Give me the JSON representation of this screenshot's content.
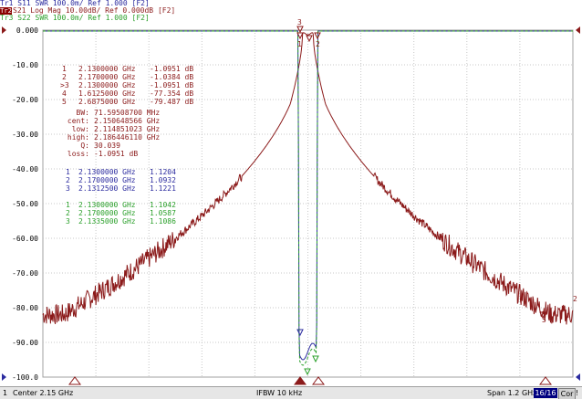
{
  "traces_header": [
    {
      "id": "Tr1",
      "label": "S11  SWR 100.0m/ Ref 1.000  [F2]",
      "color": "#2b2b9f"
    },
    {
      "id": "Tr2",
      "label": "S21  Log Mag 10.00dB/ Ref 0.000dB  [F2]",
      "color": "#8b1a1a"
    },
    {
      "id": "Tr3",
      "label": "S22  SWR 100.0m/ Ref 1.000  [F2]",
      "color": "#2ba02b"
    }
  ],
  "y_axis": {
    "ticks": [
      "0.000",
      "-10.00",
      "-20.00",
      "-30.00",
      "-40.00",
      "-50.00",
      "-60.00",
      "-70.00",
      "-80.00",
      "-90.00",
      "-100.0"
    ],
    "min": -100,
    "max": 0
  },
  "markers_s21": [
    {
      "num": "1",
      "freq": "2.1300000 GHz",
      "val": "-1.0951 dB"
    },
    {
      "num": "2",
      "freq": "2.1700000 GHz",
      "val": "-1.0384 dB"
    },
    {
      "num": ">3",
      "freq": "2.1300000 GHz",
      "val": "-1.0951 dB"
    },
    {
      "num": "4",
      "freq": "1.6125000 GHz",
      "val": "-77.354 dB"
    },
    {
      "num": "5",
      "freq": "2.6875000 GHz",
      "val": "-79.487 dB"
    }
  ],
  "bandwidth": [
    {
      "key": "BW:",
      "val": "71.59508700 MHz"
    },
    {
      "key": "cent:",
      "val": "2.150648566 GHz"
    },
    {
      "key": "low:",
      "val": "2.114851023 GHz"
    },
    {
      "key": "high:",
      "val": "2.186446110 GHz"
    },
    {
      "key": "Q:",
      "val": "30.039"
    },
    {
      "key": "loss:",
      "val": "-1.0951 dB"
    }
  ],
  "markers_s11": [
    {
      "num": "1",
      "freq": "2.1300000 GHz",
      "val": "1.1204"
    },
    {
      "num": "2",
      "freq": "2.1700000 GHz",
      "val": "1.0932"
    },
    {
      "num": "3",
      "freq": "2.1312500 GHz",
      "val": "1.1221"
    }
  ],
  "markers_s22": [
    {
      "num": "1",
      "freq": "2.1300000 GHz",
      "val": "1.1042"
    },
    {
      "num": "2",
      "freq": "2.1700000 GHz",
      "val": "1.0587"
    },
    {
      "num": "3",
      "freq": "2.1335000 GHz",
      "val": "1.1086"
    }
  ],
  "plot_labels": {
    "m3_top": "3",
    "m1": "1",
    "m2": "2",
    "m_right": "2",
    "m5": "5"
  },
  "status": {
    "channel": "1",
    "start": "Center 2.15 GHz",
    "ifbw": "IFBW 10 kHz",
    "span": "Span 1.2 GHz",
    "sweep": "16/16",
    "cor": "Cor",
    "extra": "!"
  },
  "colors": {
    "s11": "#2b2b9f",
    "s21": "#8b1a1a",
    "s22": "#2ba02b",
    "grid": "#c8c8c8",
    "bg": "#ffffff"
  }
}
